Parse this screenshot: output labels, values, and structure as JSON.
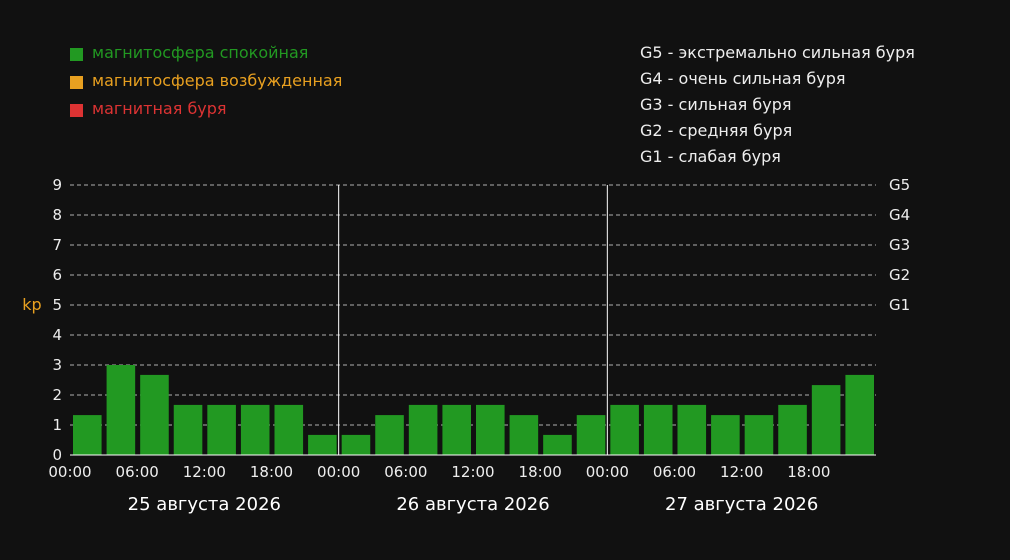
{
  "colors": {
    "background": "#111111",
    "quiet": "#229922",
    "excited": "#e8a020",
    "storm": "#dd3333",
    "text": "#eeeeee",
    "ylabel": "#e8a020",
    "grid": "#cccccc"
  },
  "legend": [
    {
      "label": "магнитосфера спокойная",
      "color": "#229922"
    },
    {
      "label": "магнитосфера возбужденная",
      "color": "#e8a020"
    },
    {
      "label": "магнитная буря",
      "color": "#dd3333"
    }
  ],
  "storm_levels": [
    "G5 - экстремально сильная буря",
    "G4 - очень сильная буря",
    "G3 - сильная буря",
    "G2 - средняя буря",
    "G1 - слабая буря"
  ],
  "chart_data": {
    "type": "bar",
    "ylabel": "kp",
    "ylim": [
      0,
      9
    ],
    "yticks": [
      "0",
      "1",
      "2",
      "3",
      "4",
      "5",
      "6",
      "7",
      "8",
      "9"
    ],
    "g_levels": [
      {
        "label": "G1",
        "kp": 5
      },
      {
        "label": "G2",
        "kp": 6
      },
      {
        "label": "G3",
        "kp": 7
      },
      {
        "label": "G4",
        "kp": 8
      },
      {
        "label": "G5",
        "kp": 9
      }
    ],
    "xticks": [
      "00:00",
      "06:00",
      "12:00",
      "18:00",
      "00:00",
      "06:00",
      "12:00",
      "18:00",
      "00:00",
      "06:00",
      "12:00",
      "18:00"
    ],
    "days": [
      "25 августа 2026",
      "26 августа 2026",
      "27 августа 2026"
    ],
    "values": [
      1.33,
      3.0,
      2.67,
      1.67,
      1.67,
      1.67,
      1.67,
      0.67,
      0.67,
      1.33,
      1.67,
      1.67,
      1.67,
      1.33,
      0.67,
      1.33,
      1.67,
      1.67,
      1.67,
      1.33,
      1.33,
      1.67,
      2.33,
      2.67
    ],
    "grid": true
  }
}
